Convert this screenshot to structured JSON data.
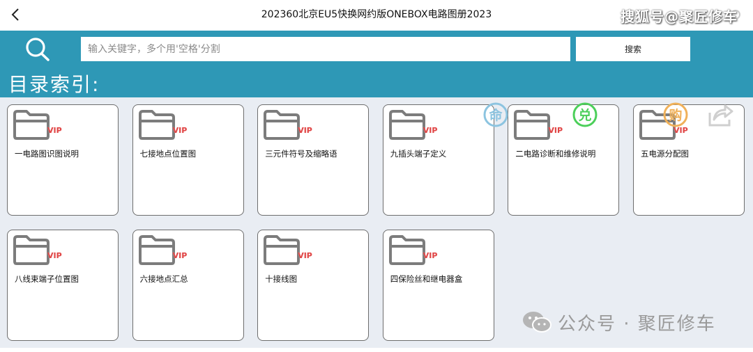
{
  "header": {
    "back_icon": "chevron-left-icon",
    "title": "202360北京EU5快换网约版ONEBOX电路图册2023"
  },
  "watermark_top": "搜狐号@聚匠修车",
  "search": {
    "placeholder": "输入关键字，多个用'空格'分割",
    "value": "",
    "button_label": "搜索",
    "icon": "search-icon"
  },
  "index": {
    "title": "目录索引:"
  },
  "folders": [
    {
      "label": "一电路图识图说明",
      "badge": "VIP"
    },
    {
      "label": "七接地点位置图",
      "badge": "VIP"
    },
    {
      "label": "三元件符号及缩略语",
      "badge": "VIP"
    },
    {
      "label": "九插头端子定义",
      "badge": "VIP"
    },
    {
      "label": "二电路诊断和维修说明",
      "badge": "VIP"
    },
    {
      "label": "五电源分配图",
      "badge": "VIP"
    },
    {
      "label": "八线束端子位置图",
      "badge": "VIP"
    },
    {
      "label": "六接地点汇总",
      "badge": "VIP"
    },
    {
      "label": "十接线图",
      "badge": "VIP"
    },
    {
      "label": "四保险丝和继电器盒",
      "badge": "VIP"
    }
  ],
  "floating_actions": [
    {
      "glyph": "命",
      "icon": "claim-icon",
      "color": "#8cc4e0"
    },
    {
      "glyph": "兑",
      "icon": "redeem-icon",
      "color": "#4ccf5a"
    },
    {
      "glyph": "购",
      "icon": "buy-icon",
      "color": "#f0b15a"
    },
    {
      "glyph": "",
      "icon": "share-icon",
      "color": "#cfcfcf"
    }
  ],
  "watermark_bottom": "公众号 · 聚匠修车",
  "colors": {
    "accent": "#2e98b6",
    "grid_bg": "#e9edf3",
    "vip": "#e04646"
  }
}
